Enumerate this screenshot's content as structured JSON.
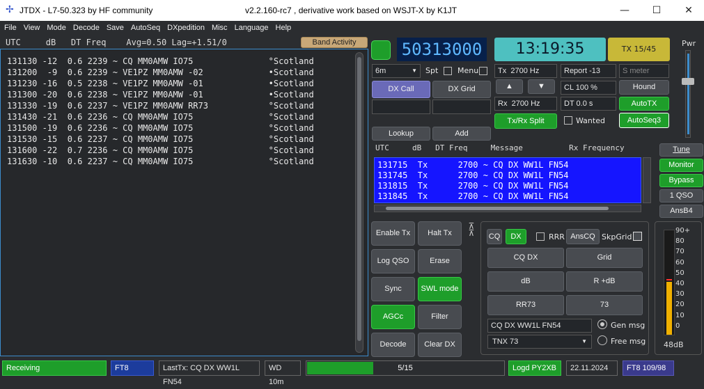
{
  "window": {
    "title": "JTDX - L7-50.323  by HF community",
    "subtitle": "v2.2.160-rc7 , derivative work based on WSJT-X by K1JT"
  },
  "menu": [
    "File",
    "View",
    "Mode",
    "Decode",
    "Save",
    "AutoSeq",
    "DXpedition",
    "Misc",
    "Language",
    "Help"
  ],
  "band": {
    "header": "UTC     dB   DT Freq    Avg=0.50 Lag=+1.51/0",
    "activity_button": "Band Activity",
    "lines": [
      "131130 -12  0.6 2239 ~ CQ MM0AMW IO75               °Scotland",
      "131200  -9  0.6 2239 ~ VE1PZ MM0AMW -02             •Scotland",
      "131230 -16  0.5 2238 ~ VE1PZ MM0AMW -01             •Scotland",
      "131300 -20  0.6 2238 ~ VE1PZ MM0AMW -01             •Scotland",
      "131330 -19  0.6 2237 ~ VE1PZ MM0AMW RR73            °Scotland",
      "131430 -21  0.6 2236 ~ CQ MM0AMW IO75               °Scotland",
      "131500 -19  0.6 2236 ~ CQ MM0AMW IO75               °Scotland",
      "131530 -15  0.6 2237 ~ CQ MM0AMW IO75               °Scotland",
      "131600 -22  0.7 2236 ~ CQ MM0AMW IO75               °Scotland",
      "131630 -10  0.6 2237 ~ CQ MM0AMW IO75               °Scotland"
    ]
  },
  "top": {
    "frequency": "50313000",
    "time": "13:19:35",
    "tx_slot": "TX 15/45",
    "pwr": "Pwr"
  },
  "controls": {
    "band": "6m",
    "spt": "Spt",
    "menu": "Menu",
    "dx_call": "DX Call",
    "dx_grid": "DX Grid",
    "lookup": "Lookup",
    "add": "Add",
    "tx_label": "Tx",
    "tx_freq": "2700 Hz",
    "rx_label": "Rx",
    "rx_freq": "2700 Hz",
    "report": "Report -13",
    "s_meter": "S meter",
    "hound": "Hound",
    "cl": "CL  100 %",
    "dt": "DT 0.0 s",
    "autotx": "AutoTX",
    "txrx_split": "Tx/Rx Split",
    "wanted": "Wanted",
    "autoseq": "AutoSeq3",
    "up": "▲",
    "down": "▼"
  },
  "rx": {
    "header": "UTC     dB   DT Freq     Message          Rx Frequency",
    "lines": [
      "131715  Tx      2700 ~ CQ DX WW1L FN54",
      "131745  Tx      2700 ~ CQ DX WW1L FN54",
      "131815  Tx      2700 ~ CQ DX WW1L FN54",
      "131845  Tx      2700 ~ CQ DX WW1L FN54"
    ]
  },
  "side": {
    "tune": "Tune",
    "monitor": "Monitor",
    "bypass": "Bypass",
    "one_qso": "1 QSO",
    "ansb4": "AnsB4"
  },
  "buttons": {
    "enable_tx": "Enable Tx",
    "halt_tx": "Halt Tx",
    "log_qso": "Log QSO",
    "erase": "Erase",
    "sync": "Sync",
    "swl": "SWL mode",
    "agcc": "AGCc",
    "filter": "Filter",
    "decode": "Decode",
    "clear_dx": "Clear DX"
  },
  "msg": {
    "cq": "CQ",
    "dx": "DX",
    "rrr": "RRR",
    "anscq": "AnsCQ",
    "skpgrid": "SkpGrid",
    "cq_dx": "CQ DX",
    "grid": "Grid",
    "db": "dB",
    "r_db": "R +dB",
    "rr73": "RR73",
    "73": "73",
    "gen_text": "CQ DX WW1L FN54",
    "gen_msg": "Gen msg",
    "free_text": "TNX 73",
    "free_msg": "Free msg"
  },
  "meter": {
    "ticks": [
      "90+",
      "80",
      "70",
      "60",
      "50",
      "40",
      "30",
      "20",
      "10",
      "0"
    ],
    "value_db": "48dB",
    "level_db": 48
  },
  "status": {
    "receiving": "Receiving",
    "mode": "FT8",
    "lasttx": "LastTx: CQ DX WW1L FN54",
    "wd": "WD 10m",
    "progress": "5/15",
    "progress_value": 0.3333,
    "logd": "Logd PY2XB",
    "date": "22.11.2024",
    "ft8": "FT8  109/98"
  },
  "colors": {
    "green": "#1e9e2a",
    "blue": "#1515ff",
    "freq_bg": "#07204a",
    "time_bg": "#4ec0c0",
    "tx_slot_bg": "#c8b838"
  }
}
